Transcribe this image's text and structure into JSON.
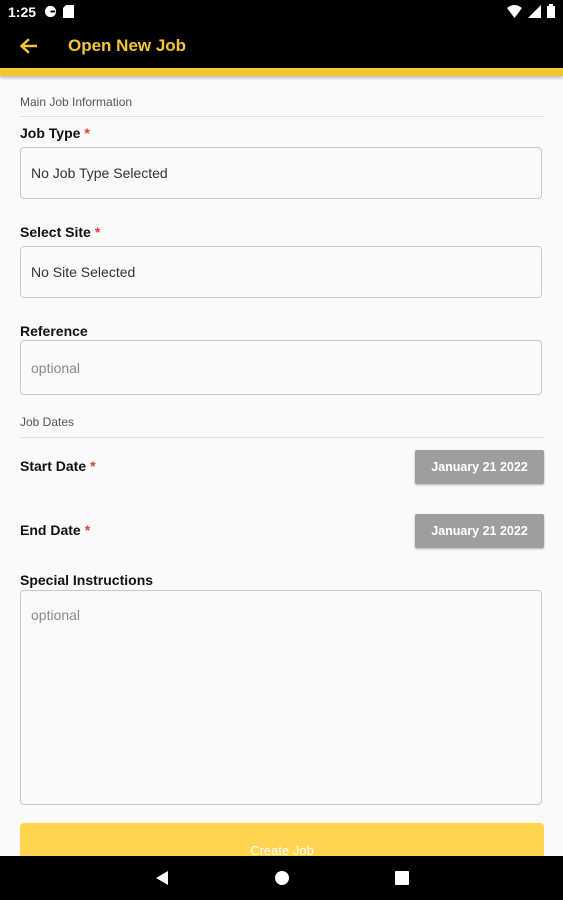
{
  "status_bar": {
    "time": "1:25"
  },
  "app_bar": {
    "title": "Open New Job"
  },
  "sections": {
    "main": "Main Job Information",
    "dates": "Job Dates"
  },
  "fields": {
    "job_type": {
      "label": "Job Type",
      "value": "No Job Type Selected",
      "required": "*"
    },
    "site": {
      "label": "Select Site",
      "value": "No Site Selected",
      "required": "*"
    },
    "reference": {
      "label": "Reference",
      "placeholder": "optional"
    },
    "start_date": {
      "label": "Start Date",
      "value": "January 21 2022",
      "required": "*"
    },
    "end_date": {
      "label": "End Date",
      "value": "January 21 2022",
      "required": "*"
    },
    "special_instructions": {
      "label": "Special Instructions",
      "placeholder": "optional"
    }
  },
  "actions": {
    "create": "Create Job"
  },
  "colors": {
    "accent": "#f5c533",
    "button": "#ffd54f",
    "date_button": "#9e9e9e",
    "required": "#e53935"
  }
}
